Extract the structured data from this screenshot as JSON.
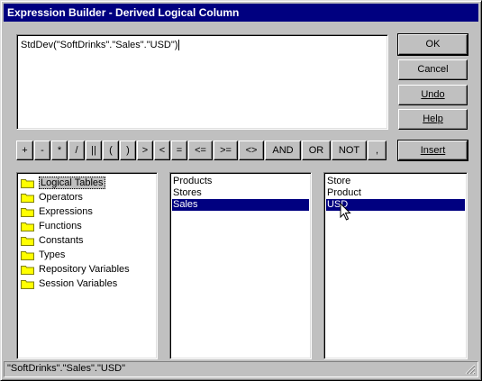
{
  "window": {
    "title": "Expression Builder - Derived Logical Column",
    "close_glyph": "×"
  },
  "expression": {
    "text": "StdDev(\"SoftDrinks\".\"Sales\".\"USD\")"
  },
  "buttons": {
    "ok": "OK",
    "cancel": "Cancel",
    "undo": "Undo",
    "help": "Help",
    "insert": "Insert"
  },
  "operators": [
    "+",
    "-",
    "*",
    "/",
    "||",
    "(",
    ")",
    ">",
    "<",
    "=",
    "<=",
    ">=",
    "<>",
    "AND",
    "OR",
    "NOT",
    ","
  ],
  "categories": [
    {
      "label": "Logical Tables",
      "selected": true
    },
    {
      "label": "Operators"
    },
    {
      "label": "Expressions"
    },
    {
      "label": "Functions"
    },
    {
      "label": "Constants"
    },
    {
      "label": "Types"
    },
    {
      "label": "Repository Variables"
    },
    {
      "label": "Session Variables"
    }
  ],
  "tables": [
    {
      "label": "Products"
    },
    {
      "label": "Stores"
    },
    {
      "label": "Sales",
      "selected": true
    }
  ],
  "columns": [
    {
      "label": "Store"
    },
    {
      "label": "Product"
    },
    {
      "label": "USD",
      "selected": true
    }
  ],
  "status": {
    "text": "\"SoftDrinks\".\"Sales\".\"USD\""
  },
  "colors": {
    "title_bar": "#000080",
    "face": "#c0c0c0",
    "selection": "#000080",
    "folder": "#ffff00"
  },
  "icons": {
    "folder": "folder-icon",
    "cursor": "mouse-pointer-icon",
    "grip": "size-grip-icon"
  }
}
